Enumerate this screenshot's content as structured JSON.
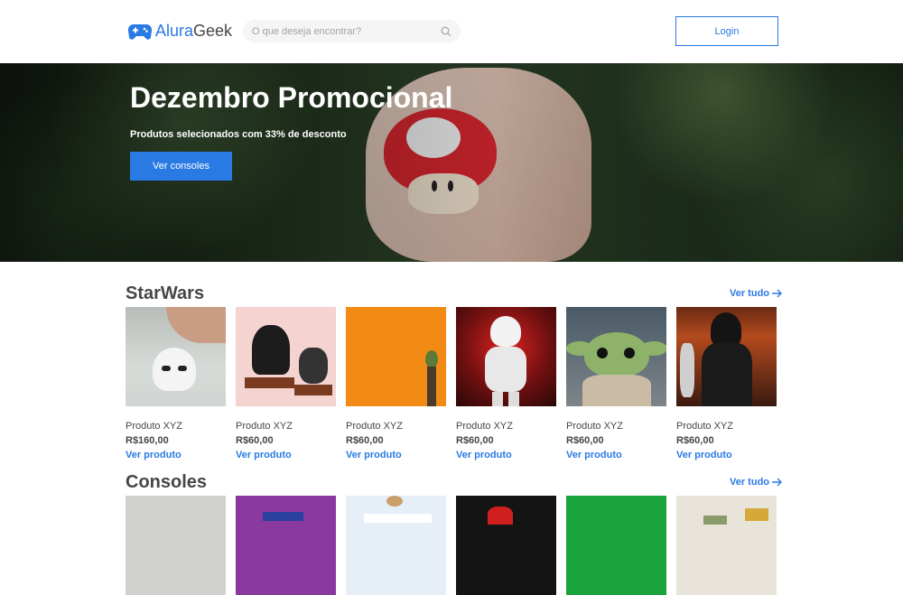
{
  "header": {
    "logo_part1": "Alura",
    "logo_part2": "Geek",
    "search_placeholder": "O que deseja encontrar?",
    "login_label": "Login"
  },
  "banner": {
    "title": "Dezembro Promocional",
    "subtitle": "Produtos selecionados com 33% de desconto",
    "button_label": "Ver consoles"
  },
  "sections": [
    {
      "title": "StarWars",
      "see_all": "Ver tudo",
      "products": [
        {
          "name": "Produto XYZ",
          "price": "R$160,00",
          "link": "Ver produto"
        },
        {
          "name": "Produto XYZ",
          "price": "R$60,00",
          "link": "Ver produto"
        },
        {
          "name": "Produto XYZ",
          "price": "R$60,00",
          "link": "Ver produto"
        },
        {
          "name": "Produto XYZ",
          "price": "R$60,00",
          "link": "Ver produto"
        },
        {
          "name": "Produto XYZ",
          "price": "R$60,00",
          "link": "Ver produto"
        },
        {
          "name": "Produto XYZ",
          "price": "R$60,00",
          "link": "Ver produto"
        }
      ]
    },
    {
      "title": "Consoles",
      "see_all": "Ver tudo"
    }
  ],
  "colors": {
    "accent": "#2A7AE4",
    "text": "#464646"
  }
}
